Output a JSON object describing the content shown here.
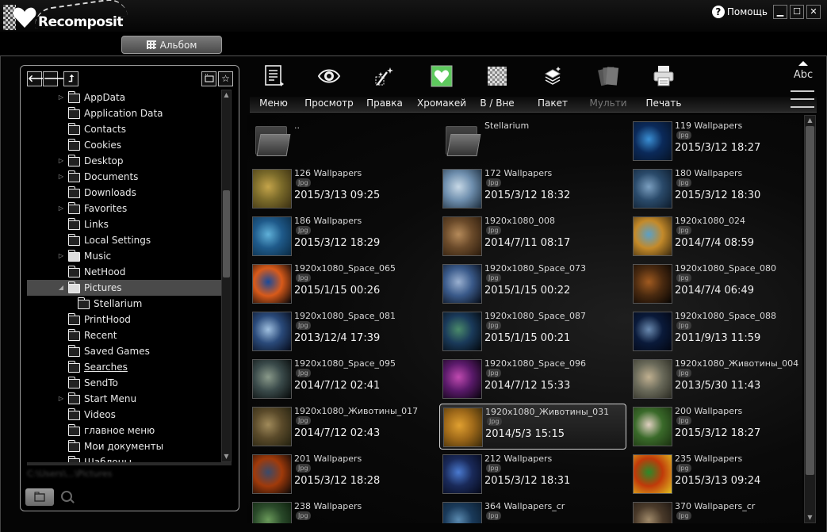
{
  "app": {
    "logo_text": "Recomposit",
    "help_label": "Помощь",
    "minimize_glyph": "▁",
    "maximize_glyph": "☐",
    "close_glyph": "✕"
  },
  "album_tab": {
    "label": "Альбом"
  },
  "nav": {
    "back_glyph": "🡐",
    "forward_glyph": "🡒",
    "up_glyph": "⮥",
    "bookmark_glyph": "☆"
  },
  "tree": {
    "items": [
      {
        "label": "AppData",
        "expandable": true,
        "indent": 1,
        "selected": false,
        "special": false,
        "underlined": false
      },
      {
        "label": "Application Data",
        "expandable": false,
        "indent": 1,
        "selected": false,
        "special": false,
        "underlined": false
      },
      {
        "label": "Contacts",
        "expandable": false,
        "indent": 1,
        "selected": false,
        "special": false,
        "underlined": false
      },
      {
        "label": "Cookies",
        "expandable": false,
        "indent": 1,
        "selected": false,
        "special": false,
        "underlined": false
      },
      {
        "label": "Desktop",
        "expandable": true,
        "indent": 1,
        "selected": false,
        "special": false,
        "underlined": false
      },
      {
        "label": "Documents",
        "expandable": true,
        "indent": 1,
        "selected": false,
        "special": false,
        "underlined": false
      },
      {
        "label": "Downloads",
        "expandable": false,
        "indent": 1,
        "selected": false,
        "special": false,
        "underlined": false
      },
      {
        "label": "Favorites",
        "expandable": true,
        "indent": 1,
        "selected": false,
        "special": false,
        "underlined": false
      },
      {
        "label": "Links",
        "expandable": false,
        "indent": 1,
        "selected": false,
        "special": false,
        "underlined": false
      },
      {
        "label": "Local Settings",
        "expandable": false,
        "indent": 1,
        "selected": false,
        "special": false,
        "underlined": false
      },
      {
        "label": "Music",
        "expandable": true,
        "indent": 1,
        "selected": false,
        "special": true,
        "underlined": false
      },
      {
        "label": "NetHood",
        "expandable": false,
        "indent": 1,
        "selected": false,
        "special": false,
        "underlined": false
      },
      {
        "label": "Pictures",
        "expandable": "open",
        "indent": 1,
        "selected": true,
        "special": true,
        "underlined": false
      },
      {
        "label": "Stellarium",
        "expandable": false,
        "indent": 2,
        "selected": false,
        "special": false,
        "underlined": false
      },
      {
        "label": "PrintHood",
        "expandable": false,
        "indent": 1,
        "selected": false,
        "special": false,
        "underlined": false
      },
      {
        "label": "Recent",
        "expandable": false,
        "indent": 1,
        "selected": false,
        "special": false,
        "underlined": false
      },
      {
        "label": "Saved Games",
        "expandable": false,
        "indent": 1,
        "selected": false,
        "special": false,
        "underlined": false
      },
      {
        "label": "Searches",
        "expandable": false,
        "indent": 1,
        "selected": false,
        "special": false,
        "underlined": true
      },
      {
        "label": "SendTo",
        "expandable": false,
        "indent": 1,
        "selected": false,
        "special": false,
        "underlined": false
      },
      {
        "label": "Start Menu",
        "expandable": true,
        "indent": 1,
        "selected": false,
        "special": false,
        "underlined": false
      },
      {
        "label": "Videos",
        "expandable": false,
        "indent": 1,
        "selected": false,
        "special": false,
        "underlined": false
      },
      {
        "label": "главное меню",
        "expandable": false,
        "indent": 1,
        "selected": false,
        "special": false,
        "underlined": false
      },
      {
        "label": "Мои документы",
        "expandable": false,
        "indent": 1,
        "selected": false,
        "special": false,
        "underlined": false
      },
      {
        "label": "Шаблоны",
        "expandable": false,
        "indent": 1,
        "selected": false,
        "special": false,
        "underlined": false
      }
    ],
    "status_blurred": "C:\\Users\\...\\Pictures"
  },
  "toolbar": {
    "tools": [
      {
        "label": "Меню",
        "icon": "menu-icon",
        "disabled": false
      },
      {
        "label": "Просмотр",
        "icon": "eye-icon",
        "disabled": false
      },
      {
        "label": "Правка",
        "icon": "magic-wand-icon",
        "disabled": false
      },
      {
        "label": "Хромакей",
        "icon": "heart-icon",
        "disabled": false
      },
      {
        "label": "В / Вне",
        "icon": "transparency-icon",
        "disabled": false
      },
      {
        "label": "Пакет",
        "icon": "batch-icon",
        "disabled": false
      },
      {
        "label": "Мульти",
        "icon": "multi-icon",
        "disabled": true
      },
      {
        "label": "Печать",
        "icon": "printer-icon",
        "disabled": false
      }
    ],
    "sort_label": "Abc"
  },
  "grid": {
    "items": [
      {
        "name": "..",
        "type": "folder",
        "date": "",
        "badge": "",
        "colors": []
      },
      {
        "name": "Stellarium",
        "type": "folder",
        "date": "",
        "badge": "",
        "colors": []
      },
      {
        "name": "119 Wallpapers",
        "type": "image",
        "date": "2015/3/12 18:27",
        "badge": "Jpg",
        "colors": [
          "#0b2a5a",
          "#3a8fd4",
          "#061224"
        ]
      },
      {
        "name": "126 Wallpapers",
        "type": "image",
        "date": "2015/3/13 09:25",
        "badge": "Jpg",
        "colors": [
          "#7a6a2a",
          "#c4a44a",
          "#3a2f12"
        ]
      },
      {
        "name": "172 Wallpapers",
        "type": "image",
        "date": "2015/3/12 18:32",
        "badge": "Jpg",
        "colors": [
          "#6f8fae",
          "#c7d8e6",
          "#1b2c3c"
        ]
      },
      {
        "name": "180 Wallpapers",
        "type": "image",
        "date": "2015/3/12 18:30",
        "badge": "Jpg",
        "colors": [
          "#2a4a6a",
          "#7b9fc0",
          "#0c1a2a"
        ]
      },
      {
        "name": "186 Wallpapers",
        "type": "image",
        "date": "2015/3/12 18:29",
        "badge": "Jpg",
        "colors": [
          "#1f5a8a",
          "#5fb0d8",
          "#0a2a44"
        ]
      },
      {
        "name": "1920x1080_008",
        "type": "image",
        "date": "2014/7/11 08:17",
        "badge": "Jpg",
        "colors": [
          "#6a4a2a",
          "#b58a5a",
          "#2a1a0c"
        ]
      },
      {
        "name": "1920x1080_024",
        "type": "image",
        "date": "2014/7/4 08:59",
        "badge": "Jpg",
        "colors": [
          "#c48a2a",
          "#5aa0c8",
          "#3a2a10"
        ]
      },
      {
        "name": "1920x1080_Space_065",
        "type": "image",
        "date": "2015/1/15 00:26",
        "badge": "Jpg",
        "colors": [
          "#d85a1a",
          "#1a4a9a",
          "#020408"
        ]
      },
      {
        "name": "1920x1080_Space_073",
        "type": "image",
        "date": "2015/1/15 00:22",
        "badge": "Jpg",
        "colors": [
          "#3a5a8a",
          "#9ab0d0",
          "#050a14"
        ]
      },
      {
        "name": "1920x1080_Space_080",
        "type": "image",
        "date": "2014/7/4 06:49",
        "badge": "Jpg",
        "colors": [
          "#4a2a10",
          "#a05a20",
          "#050302"
        ]
      },
      {
        "name": "1920x1080_Space_081",
        "type": "image",
        "date": "2013/12/4 17:39",
        "badge": "Jpg",
        "colors": [
          "#2a4a7a",
          "#a0c0e0",
          "#050a18"
        ]
      },
      {
        "name": "1920x1080_Space_087",
        "type": "image",
        "date": "2015/1/15 00:21",
        "badge": "Jpg",
        "colors": [
          "#1a3a5a",
          "#4a8a6a",
          "#02060a"
        ]
      },
      {
        "name": "1920x1080_Space_088",
        "type": "image",
        "date": "2011/9/13 11:59",
        "badge": "Jpg",
        "colors": [
          "#0a1a3a",
          "#6a8ab0",
          "#020510"
        ]
      },
      {
        "name": "1920x1080_Space_095",
        "type": "image",
        "date": "2014/7/12 02:41",
        "badge": "Jpg",
        "colors": [
          "#3a4a4a",
          "#8a9a8a",
          "#050808"
        ]
      },
      {
        "name": "1920x1080_Space_096",
        "type": "image",
        "date": "2014/7/12 15:33",
        "badge": "Jpg",
        "colors": [
          "#5a1a6a",
          "#c04ab0",
          "#050208"
        ]
      },
      {
        "name": "1920x1080_Животины_004",
        "type": "image",
        "date": "2013/5/30 11:43",
        "badge": "Jpg",
        "colors": [
          "#6a6a5a",
          "#c0b090",
          "#2a2a22"
        ]
      },
      {
        "name": "1920x1080_Животины_017",
        "type": "image",
        "date": "2014/7/12 02:43",
        "badge": "Jpg",
        "colors": [
          "#5a4a2a",
          "#a08a5a",
          "#22200f"
        ]
      },
      {
        "name": "1920x1080_Животины_031",
        "type": "image",
        "date": "2014/5/3 15:15",
        "badge": "Jpg",
        "colors": [
          "#a06a1a",
          "#e0a030",
          "#3a2a0a"
        ],
        "selected": true
      },
      {
        "name": "200 Wallpapers",
        "type": "image",
        "date": "2015/3/12 18:27",
        "badge": "Jpg",
        "colors": [
          "#3a6a2a",
          "#e0d0c0",
          "#1a3010"
        ]
      },
      {
        "name": "201 Wallpapers",
        "type": "image",
        "date": "2015/3/12 18:28",
        "badge": "Jpg",
        "colors": [
          "#a03a0a",
          "#3a4a6a",
          "#0a0808"
        ]
      },
      {
        "name": "212 Wallpapers",
        "type": "image",
        "date": "2015/3/12 18:31",
        "badge": "Jpg",
        "colors": [
          "#1a2a5a",
          "#4a7ad0",
          "#050818"
        ]
      },
      {
        "name": "235 Wallpapers",
        "type": "image",
        "date": "2015/3/13 09:24",
        "badge": "Jpg",
        "colors": [
          "#c03a0a",
          "#2a8a2a",
          "#e0c020"
        ]
      },
      {
        "name": "238 Wallpapers",
        "type": "image",
        "date": "",
        "badge": "Jpg",
        "colors": [
          "#2a4a2a",
          "#6a9a5a",
          "#0a1a0a"
        ]
      },
      {
        "name": "364 Wallpapers_cr",
        "type": "image",
        "date": "",
        "badge": "Jpg",
        "colors": [
          "#1a3a5a",
          "#5a8ab0",
          "#0a1a2a"
        ]
      },
      {
        "name": "370 Wallpapers_cr",
        "type": "image",
        "date": "",
        "badge": "Jpg",
        "colors": [
          "#4a3a2a",
          "#a08a6a",
          "#1a1410"
        ]
      }
    ]
  },
  "colors": {
    "accent_heart": "#5ec95e",
    "selected_row": "#4a4a4a"
  }
}
